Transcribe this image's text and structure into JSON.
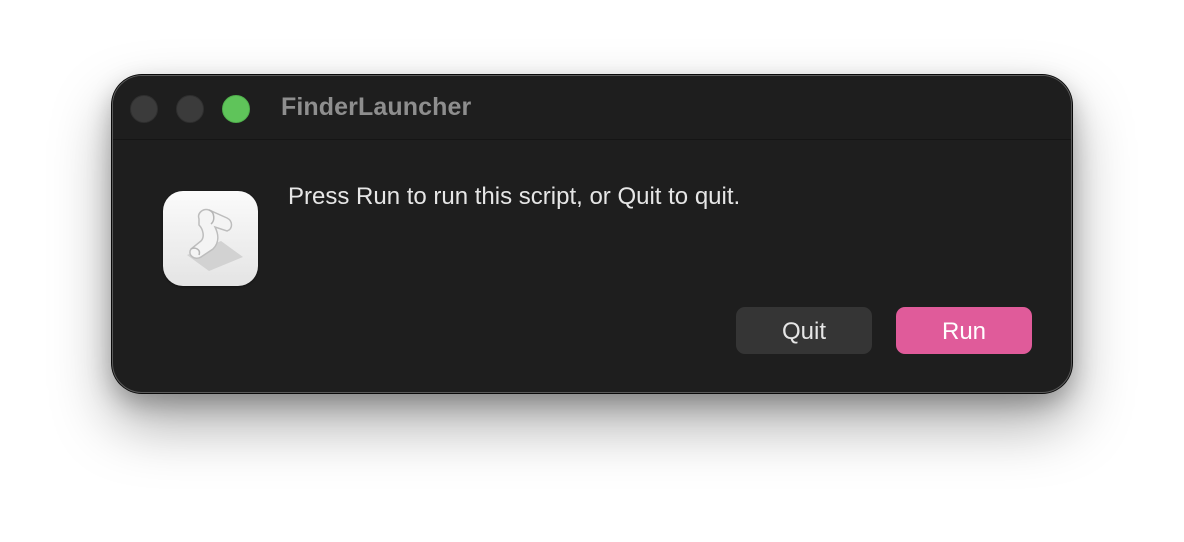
{
  "window": {
    "title": "FinderLauncher",
    "controls": {
      "close": "close-button",
      "minimize": "minimize-button",
      "zoom": "zoom-button"
    }
  },
  "dialog": {
    "icon": "script-editor-icon",
    "message": "Press Run to run this script, or Quit to quit.",
    "quit_label": "Quit",
    "run_label": "Run"
  },
  "colors": {
    "accent": "#e05b9a",
    "window_bg": "#1e1e1e",
    "zoom_green": "#5fc45a"
  }
}
